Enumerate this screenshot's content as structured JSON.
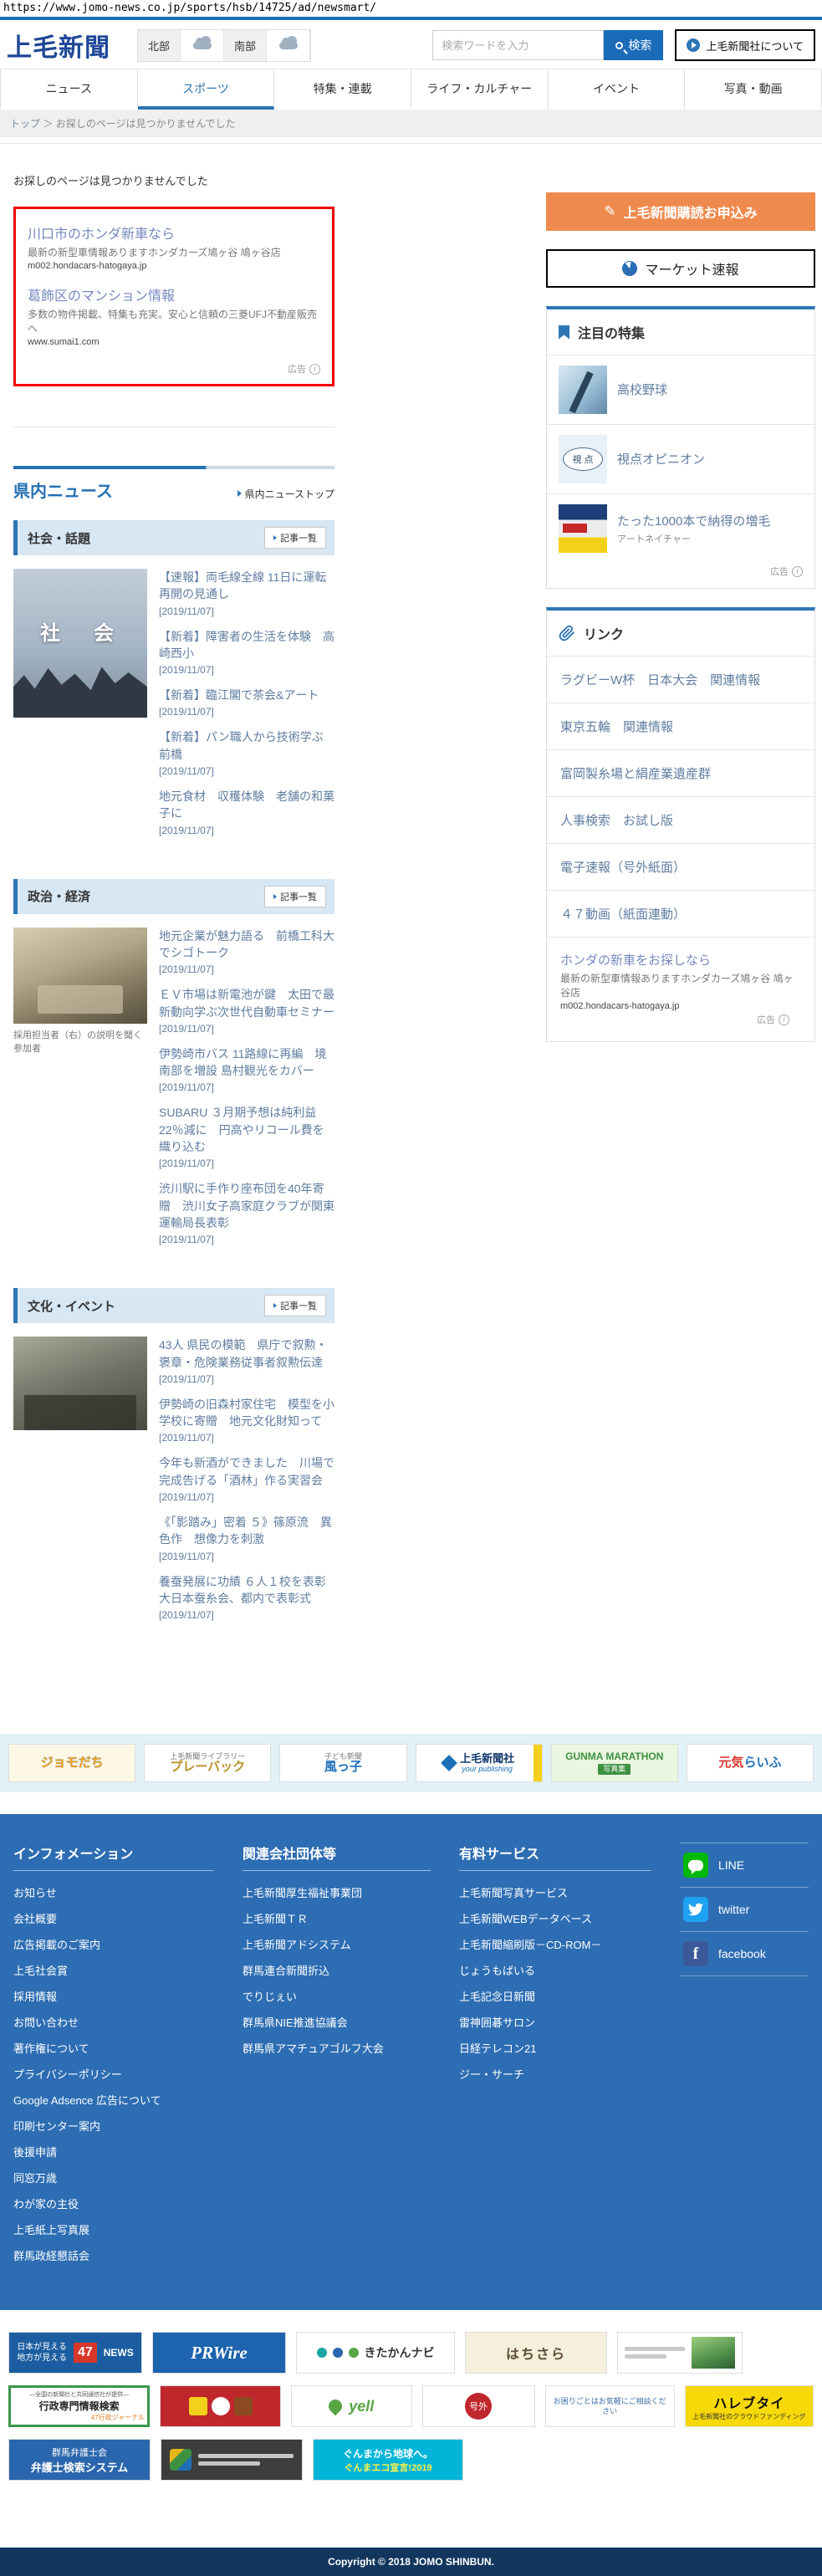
{
  "url": "https://www.jomo-news.co.jp/sports/hsb/14725/ad/newsmart/",
  "header": {
    "logo": "上毛新聞",
    "weather": {
      "north": "北部",
      "south": "南部"
    },
    "search": {
      "placeholder": "検索ワードを入力",
      "button": "検索"
    },
    "about_button": "上毛新聞社について"
  },
  "nav": {
    "tabs": [
      "ニュース",
      "スポーツ",
      "特集・連載",
      "ライフ・カルチャー",
      "イベント",
      "写真・動画"
    ]
  },
  "breadcrumb": {
    "home": "トップ",
    "separator": "＞",
    "current": "お探しのページは見つかりませんでした"
  },
  "page_title": "お探しのページは見つかりませんでした",
  "ad_box": {
    "ads": [
      {
        "title": "川口市のホンダ新車なら",
        "desc": "最新の新型車情報ありますホンダカーズ鳩ヶ谷 鳩ヶ谷店",
        "url": "m002.hondacars-hatogaya.jp"
      },
      {
        "title": "葛飾区のマンション情報",
        "desc": "多数の物件掲載、特集も充実。安心と信頼の三菱UFJ不動産販売へ",
        "url": "www.sumai1.com"
      }
    ],
    "ad_label": "広告"
  },
  "sidebar": {
    "subscribe_button": "上毛新聞購読お申込み",
    "market_button": "マーケット速報",
    "featured": {
      "title": "注目の特集",
      "thumb2_text": "視 点",
      "items": [
        {
          "label": "高校野球",
          "sub": ""
        },
        {
          "label": "視点オピニオン",
          "sub": ""
        },
        {
          "label": "たった1000本で納得の増毛",
          "sub": "アートネイチャー"
        }
      ],
      "ad_label": "広告"
    },
    "links": {
      "title": "リンク",
      "items": [
        "ラグビーW杯　日本大会　関連情報",
        "東京五輪　関連情報",
        "富岡製糸場と絹産業遺産群",
        "人事検索　お試し版",
        "電子速報（号外紙面）",
        "４７動画（紙面連動）"
      ],
      "ad": {
        "title": "ホンダの新車をお探しなら",
        "desc": "最新の新型車情報ありますホンダカーズ鳩ヶ谷 鳩ヶ谷店",
        "url": "m002.hondacars-hatogaya.jp",
        "ad_label": "広告"
      }
    }
  },
  "news": {
    "title": "県内ニュース",
    "top_link": "県内ニューストップ",
    "more_label": "記事一覧",
    "sections": [
      {
        "title": "社会・話題",
        "photo_text": "社　会",
        "items": [
          {
            "title": "【速報】両毛線全線 11日に運転再開の見通し",
            "date": "[2019/11/07]"
          },
          {
            "title": "【新着】障害者の生活を体験　高崎西小",
            "date": "[2019/11/07]"
          },
          {
            "title": "【新着】臨江閣で茶会&アート",
            "date": "[2019/11/07]"
          },
          {
            "title": "【新着】パン職人から技術学ぶ　前橋",
            "date": "[2019/11/07]"
          },
          {
            "title": "地元食材　収穫体験　老舗の和菓子に",
            "date": "[2019/11/07]"
          }
        ]
      },
      {
        "title": "政治・経済",
        "photo_caption": "採用担当者（右）の説明を聞く参加者",
        "items": [
          {
            "title": "地元企業が魅力語る　前橋工科大でシゴトーク",
            "date": "[2019/11/07]"
          },
          {
            "title": "ＥＶ市場は新電池が鍵　太田で最新動向学ぶ次世代自動車セミナー",
            "date": "[2019/11/07]"
          },
          {
            "title": "伊勢崎市バス 11路線に再編　境南部を増設 島村観光をカバー",
            "date": "[2019/11/07]"
          },
          {
            "title": "SUBARU ３月期予想は純利益22％減に　円高やリコール費を織り込む",
            "date": "[2019/11/07]"
          },
          {
            "title": "渋川駅に手作り座布団を40年寄贈　渋川女子高家庭クラブが関東運輸局長表彰",
            "date": "[2019/11/07]"
          }
        ]
      },
      {
        "title": "文化・イベント",
        "items": [
          {
            "title": "43人 県民の模範　県庁で叙勲・褒章・危険業務従事者叙勲伝達",
            "date": "[2019/11/07]"
          },
          {
            "title": "伊勢崎の旧森村家住宅　模型を小学校に寄贈　地元文化財知って",
            "date": "[2019/11/07]"
          },
          {
            "title": "今年も新酒ができました　川場で完成告げる「酒林」作る実習会",
            "date": "[2019/11/07]"
          },
          {
            "title": "《「影踏み」密着 ５》篠原流　異色作　想像力を刺激",
            "date": "[2019/11/07]"
          },
          {
            "title": "養蚕発展に功績 ６人１校を表彰　大日本蚕糸会、都内で表彰式",
            "date": "[2019/11/07]"
          }
        ]
      }
    ]
  },
  "partner_banners": {
    "jomodachi": {
      "label": "ジョモだち"
    },
    "playback": {
      "label": "プレーバック",
      "sub": "上毛新聞ライブラリー"
    },
    "kazakko": {
      "label": "風っ子",
      "sub": "子ども新聞"
    },
    "publishing": {
      "label": "上毛新聞社",
      "sub": "your publishing"
    },
    "marathon": {
      "label": "GUNMA MARATHON",
      "sub": "写真集"
    },
    "genki": {
      "label_red": "元気",
      "label_blue": "らいふ"
    }
  },
  "footer": {
    "columns": [
      {
        "title": "インフォメーション",
        "links": [
          "お知らせ",
          "会社概要",
          "広告掲載のご案内",
          "上毛社会賞",
          "採用情報",
          "お問い合わせ",
          "著作権について",
          "プライバシーポリシー",
          "Google Adsence 広告について",
          "印刷センター案内",
          "後援申請",
          "同窓万歳",
          "わが家の主役",
          "上毛紙上写真展",
          "群馬政経懇話会"
        ]
      },
      {
        "title": "関連会社団体等",
        "links": [
          "上毛新聞厚生福祉事業団",
          "上毛新聞ＴＲ",
          "上毛新聞アドシステム",
          "群馬連合新聞折込",
          "でりじぇい",
          "群馬県NIE推進協議会",
          "群馬県アマチュアゴルフ大会"
        ]
      },
      {
        "title": "有料サービス",
        "links": [
          "上毛新聞写真サービス",
          "上毛新聞WEBデータベース",
          "上毛新聞縮刷版－CD-ROM－",
          "じょうもばいる",
          "上毛記念日新聞",
          "雷神囲碁サロン",
          "日経テレコン21",
          "ジー・サーチ"
        ]
      }
    ],
    "sns": [
      "LINE",
      "twitter",
      "facebook"
    ]
  },
  "bottom": {
    "news47": {
      "line1": "日本が見える",
      "line2": "地方が見える",
      "num": "47",
      "news": "NEWS"
    },
    "prwire": {
      "label": "PRWire"
    },
    "kitakan": {
      "label": "きたかんナビ"
    },
    "hachisara": {
      "label": "はちさら"
    },
    "gyosei": {
      "small": "―全国の新聞社と共同通信社が提供―",
      "label": "行政専門情報検索",
      "sub": "47行政ジャーナル"
    },
    "yell": {
      "label": "yell"
    },
    "gogai": {
      "label": "号外"
    },
    "consult": {
      "label": "お困りごとはお気軽にご相談ください"
    },
    "harebutai": {
      "label": "ハレブタイ",
      "sub": "上毛新聞社のクラウドファンディング"
    },
    "bengoshi": {
      "line1": "群馬弁護士会",
      "line2": "弁護士検索システム"
    },
    "eco": {
      "line1": "ぐんまから地球へ。",
      "line2": "ぐんまエコ宣言!2019"
    }
  },
  "copyright": "Copyright © 2018 JOMO SHINBUN."
}
